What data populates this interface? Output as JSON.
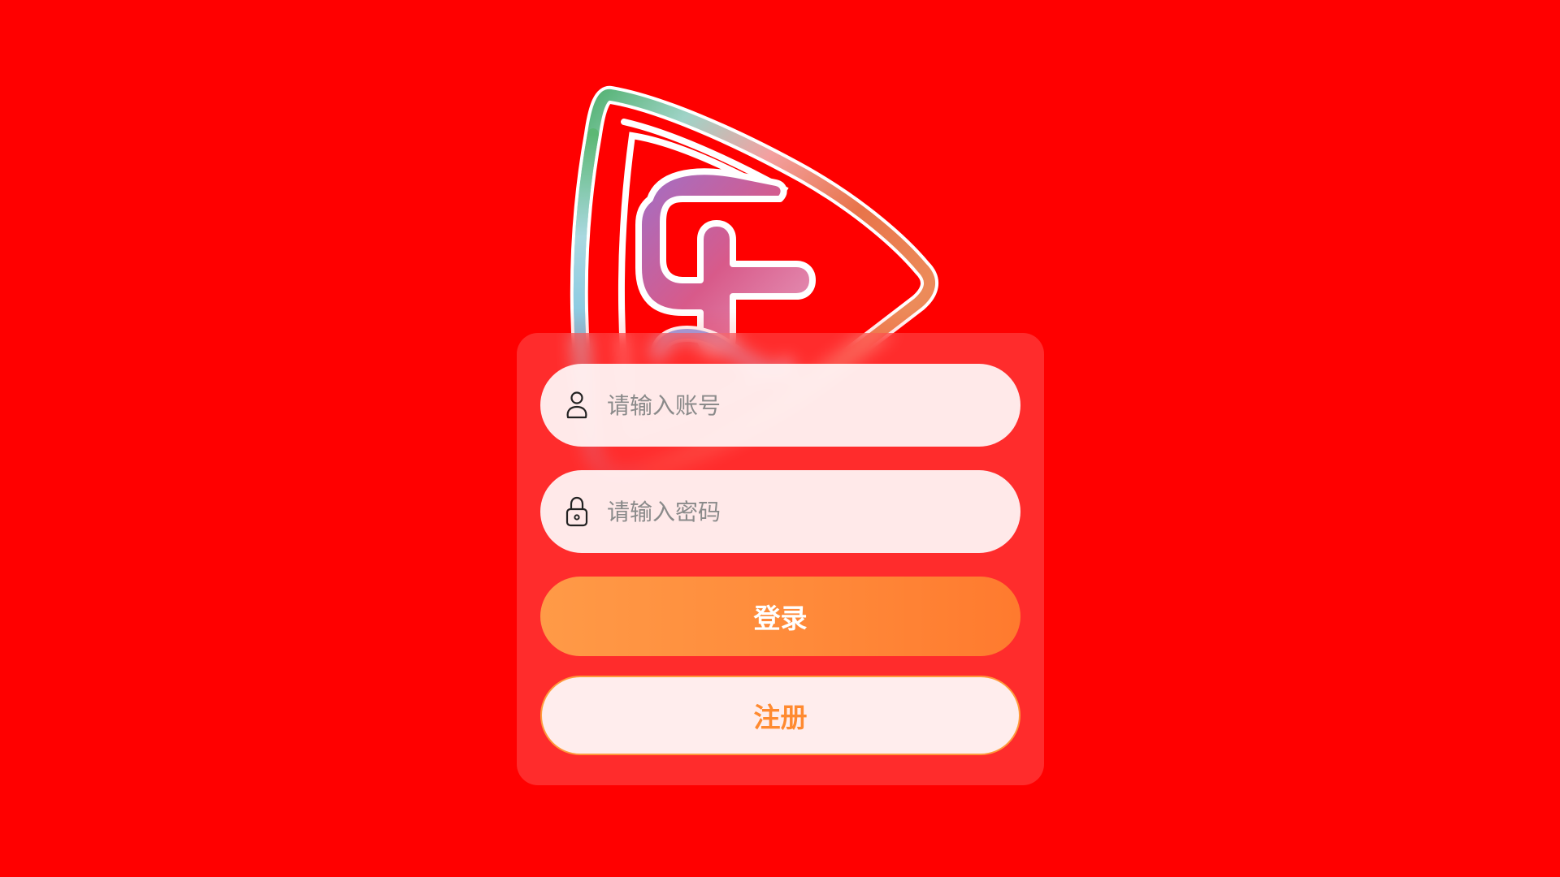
{
  "login_form": {
    "account_placeholder": "请输入账号",
    "account_value": "",
    "password_placeholder": "请输入密码",
    "password_value": "",
    "login_label": "登录",
    "register_label": "注册"
  },
  "icons": {
    "logo": "shield-logo-icon",
    "account": "user-icon",
    "password": "lock-icon"
  },
  "colors": {
    "background": "#ff0000",
    "card": "#ff5050",
    "input_bg": "#fff8f8",
    "login_button": "#ff8a3a",
    "register_text": "#ff8a30",
    "register_border": "#ff9a3c",
    "placeholder": "#8a8a8a"
  }
}
